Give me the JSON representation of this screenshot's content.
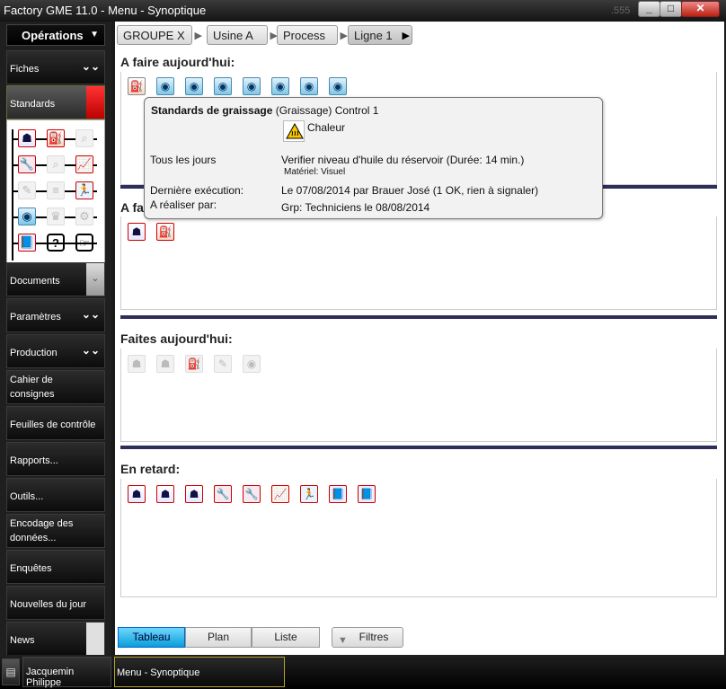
{
  "window": {
    "title": "Factory GME 11.0 - Menu - Synoptique",
    "version_tag": ".555"
  },
  "sidebar": {
    "operations_label": "Opérations",
    "items": [
      {
        "label": "Fiches"
      },
      {
        "label": "Standards"
      },
      {
        "label": "Documents"
      },
      {
        "label": "Paramètres"
      },
      {
        "label": "Production"
      },
      {
        "label": "Cahier de consignes"
      },
      {
        "label": "Feuilles de contrôle"
      },
      {
        "label": "Rapports..."
      },
      {
        "label": "Outils..."
      },
      {
        "label": "Encodage des données..."
      },
      {
        "label": "Enquêtes"
      },
      {
        "label": "Nouvelles du jour"
      },
      {
        "label": "News"
      }
    ],
    "standards_icons": [
      "person-icon",
      "oil-can-icon",
      "search-icon",
      "wrench-icon",
      "search-icon",
      "chart-icon",
      "ruler-icon",
      "list-icon",
      "run-icon",
      "eye-icon",
      "crown-icon",
      "tool-icon",
      "book-icon",
      "help-icon",
      "pointer-icon"
    ]
  },
  "breadcrumb": [
    "GROUPE X",
    "Usine A",
    "Process",
    "Ligne 1"
  ],
  "sections": {
    "today": {
      "title": "A faire aujourd'hui:",
      "icons": [
        "oil-can-icon",
        "eye-icon",
        "eye-icon",
        "eye-icon",
        "eye-icon",
        "eye-icon",
        "eye-icon",
        "eye-icon"
      ]
    },
    "second": {
      "title": "A faire ...",
      "icons": [
        "person-icon",
        "oil-can-icon"
      ]
    },
    "done": {
      "title": "Faites aujourd'hui:",
      "icons": [
        "person-icon",
        "person-icon",
        "oil-can-icon",
        "ruler-icon",
        "eye-icon"
      ]
    },
    "late": {
      "title": "En retard:",
      "icons": [
        "person-icon",
        "person-icon",
        "person-icon",
        "wrench-icon",
        "wrench-icon",
        "chart-icon",
        "run-icon",
        "book-icon",
        "book-icon"
      ]
    }
  },
  "tooltip": {
    "heading_bold": "Standards de graissage",
    "heading_rest": " (Graissage) Control 1",
    "hazard": "Chaleur",
    "frequency": "Tous les jours",
    "action": "Verifier niveau d'huile du réservoir (Durée: 14 min.)",
    "material": "Matériel: Visuel",
    "last_exec_label": "Dernière exécution:",
    "last_exec_value": "Le 07/08/2014 par Brauer José (1 OK, rien à signaler)",
    "todo_by_label": "A réaliser par:",
    "todo_by_value": "Grp: Techniciens le 08/08/2014"
  },
  "view_tabs": {
    "tableau": "Tableau",
    "plan": "Plan",
    "liste": "Liste",
    "filtres": "Filtres"
  },
  "taskbar": {
    "user": "Jacquemin Philippe",
    "active": "Menu - Synoptique"
  },
  "colors": {
    "divider": "#2d2e5a",
    "accent_tab": "#0a9ed8",
    "standards_red": "#e11"
  }
}
